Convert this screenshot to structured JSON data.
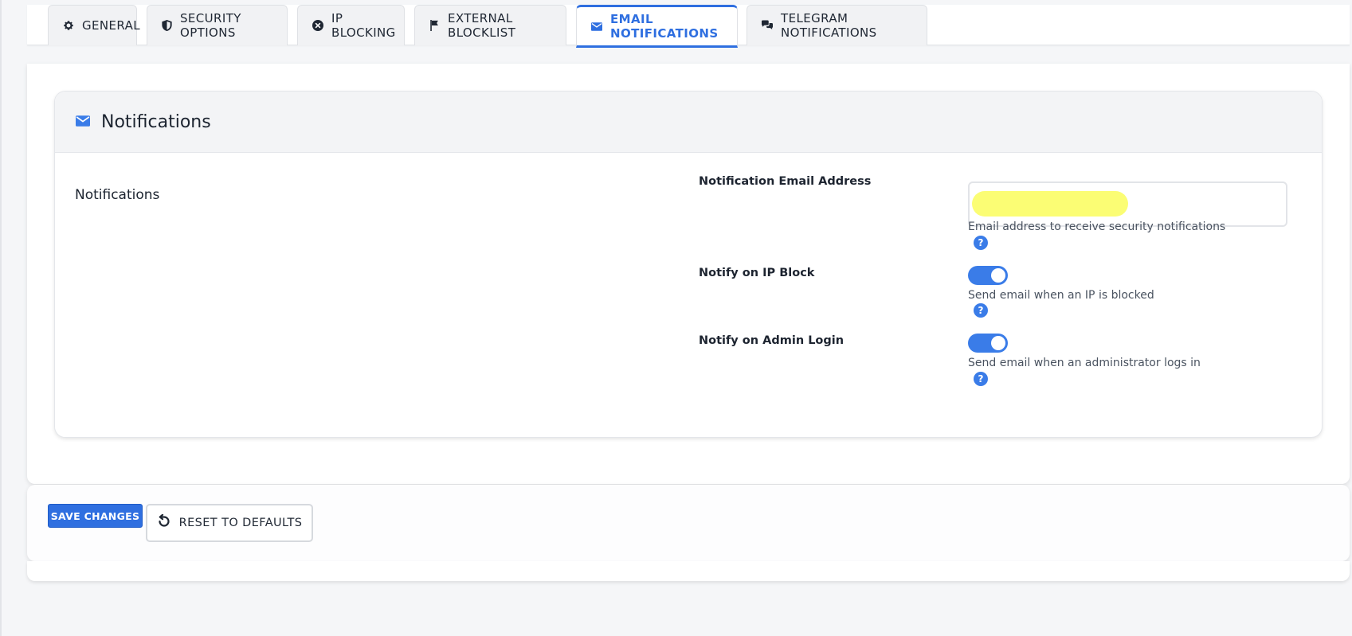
{
  "tabs": [
    {
      "label": "GENERAL",
      "icon": "gear-icon"
    },
    {
      "label": "SECURITY OPTIONS",
      "icon": "shield-icon"
    },
    {
      "label": "IP BLOCKING",
      "icon": "x-circle-icon"
    },
    {
      "label": "EXTERNAL BLOCKLIST",
      "icon": "flag-icon"
    },
    {
      "label": "EMAIL NOTIFICATIONS",
      "icon": "envelope-icon",
      "active": true
    },
    {
      "label": "TELEGRAM NOTIFICATIONS",
      "icon": "chat-icon"
    }
  ],
  "card": {
    "title": "Notifications",
    "icon": "envelope-icon",
    "section_label": "Notifications"
  },
  "fields": {
    "email": {
      "label": "Notification Email Address",
      "value": "",
      "help": "Email address to receive security notifications"
    },
    "ip_block": {
      "label": "Notify on IP Block",
      "enabled": true,
      "help": "Send email when an IP is blocked"
    },
    "admin_login": {
      "label": "Notify on Admin Login",
      "enabled": true,
      "help": "Send email when an administrator logs in"
    }
  },
  "help_icon_glyph": "?",
  "buttons": {
    "save": "SAVE CHANGES",
    "reset": "RESET TO DEFAULTS"
  },
  "colors": {
    "accent": "#2f6fe0",
    "toggle_on": "#3a7ce8",
    "redaction": "#fbfd74"
  }
}
